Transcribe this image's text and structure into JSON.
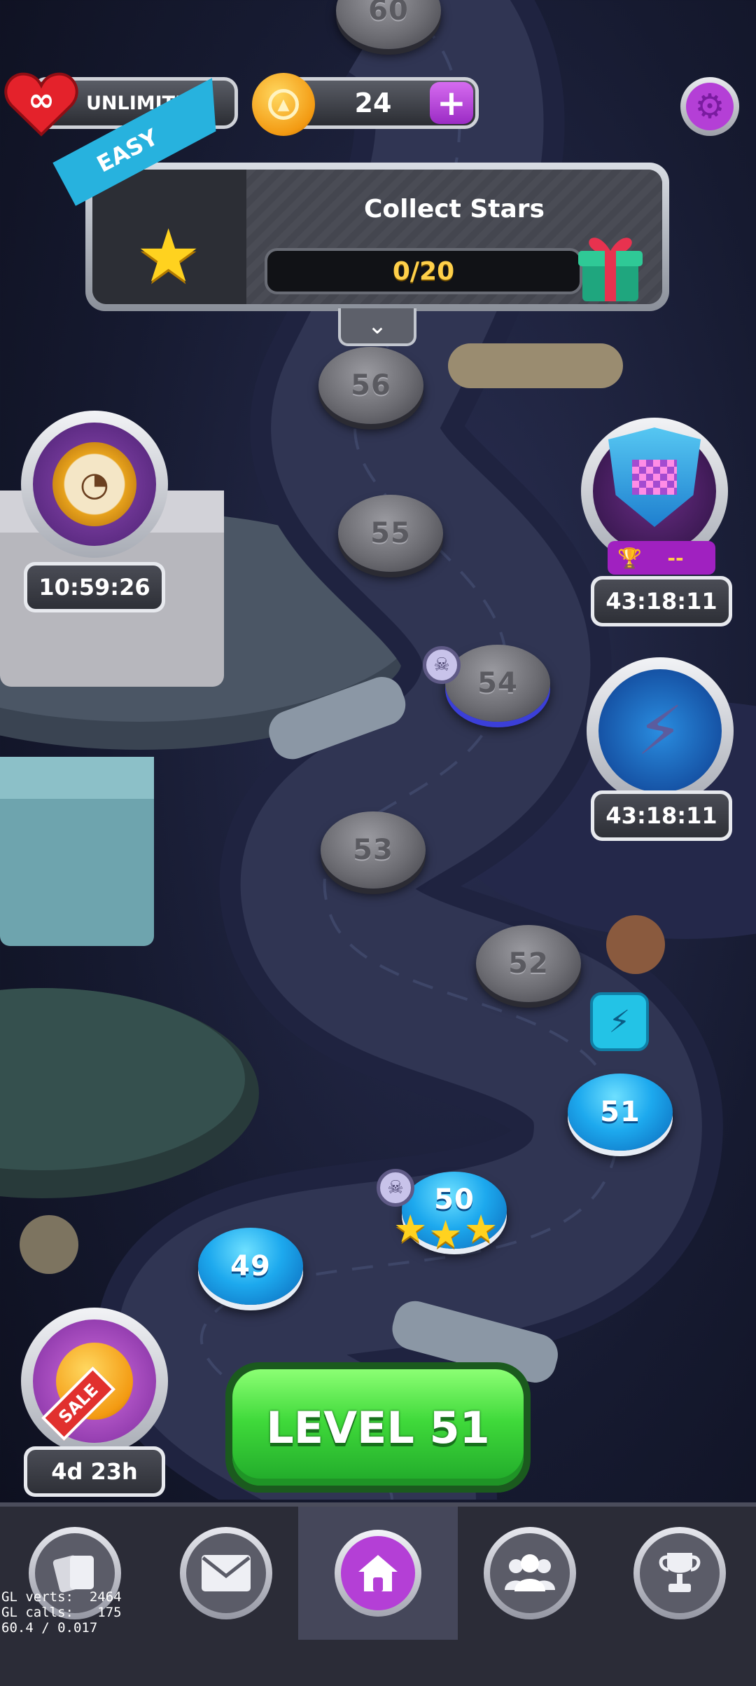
{
  "topbar": {
    "lives_label": "UNLIMITED",
    "coins": "24",
    "plus_label": "+"
  },
  "quest": {
    "difficulty": "EASY",
    "title": "Collect Stars",
    "progress_text": "0/20",
    "progress": 0
  },
  "events": {
    "left_timer": "10:59:26",
    "flag_score": "--",
    "flag_timer": "43:18:11",
    "lightning_timer": "43:18:11",
    "sale_badge": "SALE",
    "sale_timer": "4d 23h"
  },
  "levels": [
    {
      "num": "60",
      "state": "locked"
    },
    {
      "num": "56",
      "state": "locked"
    },
    {
      "num": "55",
      "state": "locked"
    },
    {
      "num": "54",
      "state": "locked"
    },
    {
      "num": "53",
      "state": "locked"
    },
    {
      "num": "52",
      "state": "locked"
    },
    {
      "num": "51",
      "state": "current"
    },
    {
      "num": "50",
      "state": "completed",
      "stars": 3
    },
    {
      "num": "49",
      "state": "open"
    }
  ],
  "play_button": "LEVEL 51",
  "nav": {
    "items": [
      "cards",
      "mail",
      "home",
      "team",
      "leaderboard"
    ],
    "active": "home"
  },
  "debug": {
    "line1": "GL verts:  2464",
    "line2": "GL calls:   175",
    "line3": "60.4 / 0.017"
  },
  "colors": {
    "accent_purple": "#b43fd6",
    "play_green": "#3fd93a",
    "level_blue": "#1da9ee",
    "star_yellow": "#ffd21f"
  }
}
